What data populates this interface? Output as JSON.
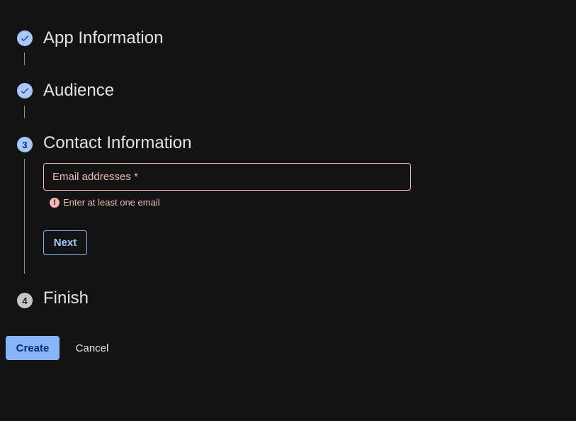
{
  "steps": [
    {
      "title": "App Information",
      "status": "done",
      "icon": "check-icon"
    },
    {
      "title": "Audience",
      "status": "done",
      "icon": "check-icon"
    },
    {
      "title": "Contact Information",
      "status": "current",
      "number": "3"
    },
    {
      "title": "Finish",
      "status": "pending",
      "number": "4"
    }
  ],
  "contact": {
    "email_label": "Email addresses *",
    "email_value": "",
    "error_message": "Enter at least one email",
    "error_icon": "!",
    "next_label": "Next"
  },
  "actions": {
    "create_label": "Create",
    "cancel_label": "Cancel"
  },
  "colors": {
    "accent": "#a8c7fa",
    "error": "#f2b8b5",
    "background": "#131314"
  }
}
